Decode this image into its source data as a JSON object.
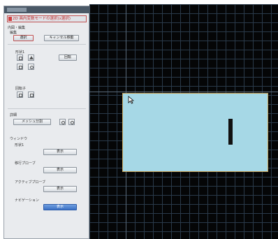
{
  "panel": {
    "title": "2D 画内変数モードの選択(x選択)",
    "section_main": "内図・編集",
    "section_edit": "編集",
    "select_label": "選択",
    "cancel_move_label": "キャンセル移動",
    "group_shapes_label": "形状1",
    "scale_label": "回転",
    "group_2_label": "回転子",
    "section_mesh": "詳細",
    "mesh_label": "メッシュ分割",
    "section_window": "ウィンドウ",
    "window_shape_label": "形状1",
    "window_shape_button": "表示",
    "window_pointer_label": "移行プローブ",
    "window_pointer_button": "表示",
    "window_active_label": "アクティブプローブ",
    "window_active_button": "表示",
    "window_navigate_label": "ナビゲーション",
    "window_navigate_button": "表示"
  },
  "colors": {
    "viewport_bg": "#050607",
    "grid": "#2a3a4a",
    "shape_fill": "#a6d8e6",
    "shape_border": "#c8a45a",
    "accent_red": "#c03030",
    "button_blue": "#3b70c4"
  }
}
